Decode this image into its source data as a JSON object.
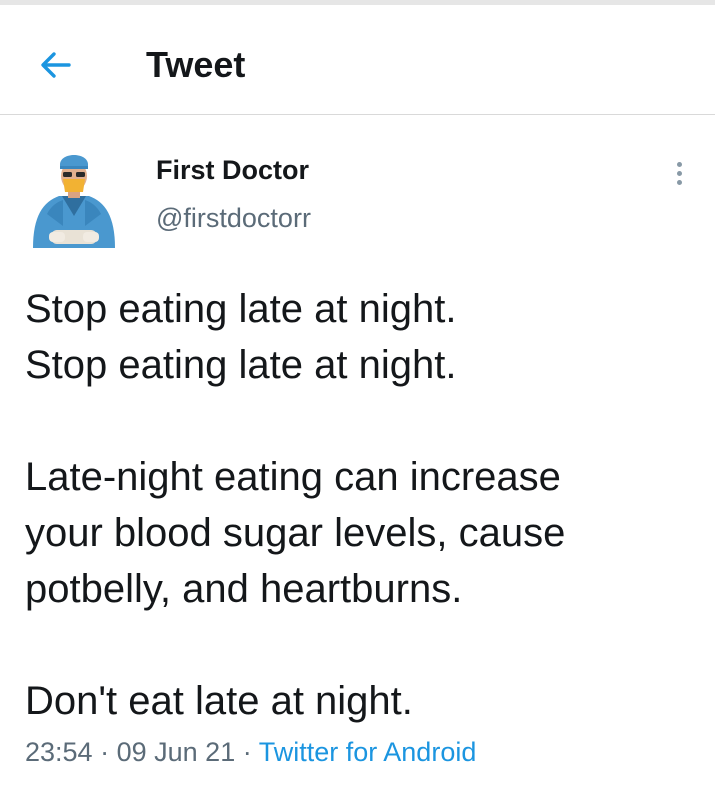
{
  "header": {
    "title": "Tweet"
  },
  "tweet": {
    "author": {
      "name": "First Doctor",
      "handle": "@firstdoctorr"
    },
    "text_lines": [
      "Stop eating late at night.",
      "Stop eating late at night.",
      "",
      "Late-night eating can increase",
      "your blood sugar levels, cause",
      "potbelly, and heartburns.",
      "",
      "Don't eat late at night."
    ],
    "time": "23:54",
    "separator": "·",
    "date": "09 Jun 21",
    "source": "Twitter for Android"
  },
  "icons": {
    "back": "arrow-left-icon",
    "more": "more-vertical-icon"
  },
  "colors": {
    "accent": "#1b95e0",
    "text_primary": "#14171a",
    "text_secondary": "#5b6b78",
    "divider": "#d9d9d9"
  }
}
